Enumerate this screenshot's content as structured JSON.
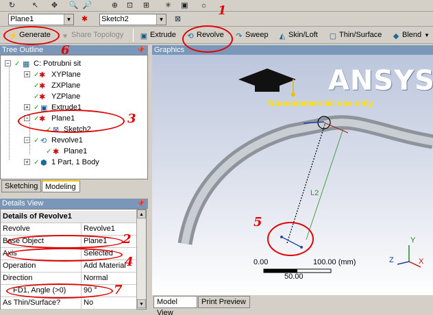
{
  "toolbar_top": {
    "icons": [
      "redo-icon",
      "select-icon",
      "zoom-box-icon",
      "zoom-icon",
      "zoom-in-icon",
      "zoom-fit-icon",
      "pan-icon",
      "view-icon"
    ]
  },
  "toolbar_plane": {
    "plane_value": "Plane1",
    "sketch_value": "Sketch2"
  },
  "toolbar_features": {
    "generate": "Generate",
    "share_topology": "Share Topology",
    "extrude": "Extrude",
    "revolve": "Revolve",
    "sweep": "Sweep",
    "skin_loft": "Skin/Loft",
    "thin_surface": "Thin/Surface",
    "blend": "Blend"
  },
  "tree_panel": {
    "title": "Tree Outline",
    "pin": "ᵖ",
    "nodes": [
      {
        "label": "C: Potrubni sit",
        "icon": "model-icon"
      },
      {
        "label": "XYPlane",
        "icon": "plane-icon"
      },
      {
        "label": "ZXPlane",
        "icon": "plane-icon"
      },
      {
        "label": "YZPlane",
        "icon": "plane-icon"
      },
      {
        "label": "Extrude1",
        "icon": "extrude-icon"
      },
      {
        "label": "Plane1",
        "icon": "plane-icon"
      },
      {
        "label": "Sketch2",
        "icon": "sketch-icon"
      },
      {
        "label": "Revolve1",
        "icon": "revolve-icon"
      },
      {
        "label": "Plane1",
        "icon": "plane-icon"
      },
      {
        "label": "1 Part, 1 Body",
        "icon": "body-icon"
      }
    ]
  },
  "tabs": {
    "sketching": "Sketching",
    "modeling": "Modeling"
  },
  "details_panel": {
    "title": "Details View",
    "header": "Details of Revolve1",
    "rows": [
      {
        "key": "Revolve",
        "value": "Revolve1"
      },
      {
        "key": "Base Object",
        "value": "Plane1"
      },
      {
        "key": "Axis",
        "value": "Selected"
      },
      {
        "key": "Operation",
        "value": "Add Material"
      },
      {
        "key": "Direction",
        "value": "Normal"
      },
      {
        "key": "FD1, Angle (>0)",
        "value": "90 °"
      },
      {
        "key": "As Thin/Surface?",
        "value": "No"
      }
    ]
  },
  "graphics": {
    "title": "Graphics",
    "ansys": "ANSYS",
    "noncommercial": "Noncommercial use only",
    "dimension": "L2",
    "scale_left": "0.00",
    "scale_right": "100.00 (mm)",
    "scale_mid": "50.00",
    "axis_x": "X",
    "axis_y": "Y",
    "axis_z": "Z"
  },
  "bottom_tabs": {
    "model_view": "Model View",
    "print_preview": "Print Preview"
  },
  "annotations": [
    "1",
    "2",
    "3",
    "4",
    "5",
    "6",
    "7"
  ],
  "colors": {
    "annotation": "#e00000",
    "panel_title": "#7a96b8",
    "watermark_sub": "#ffe000",
    "pipe": "#a9aeb6"
  }
}
